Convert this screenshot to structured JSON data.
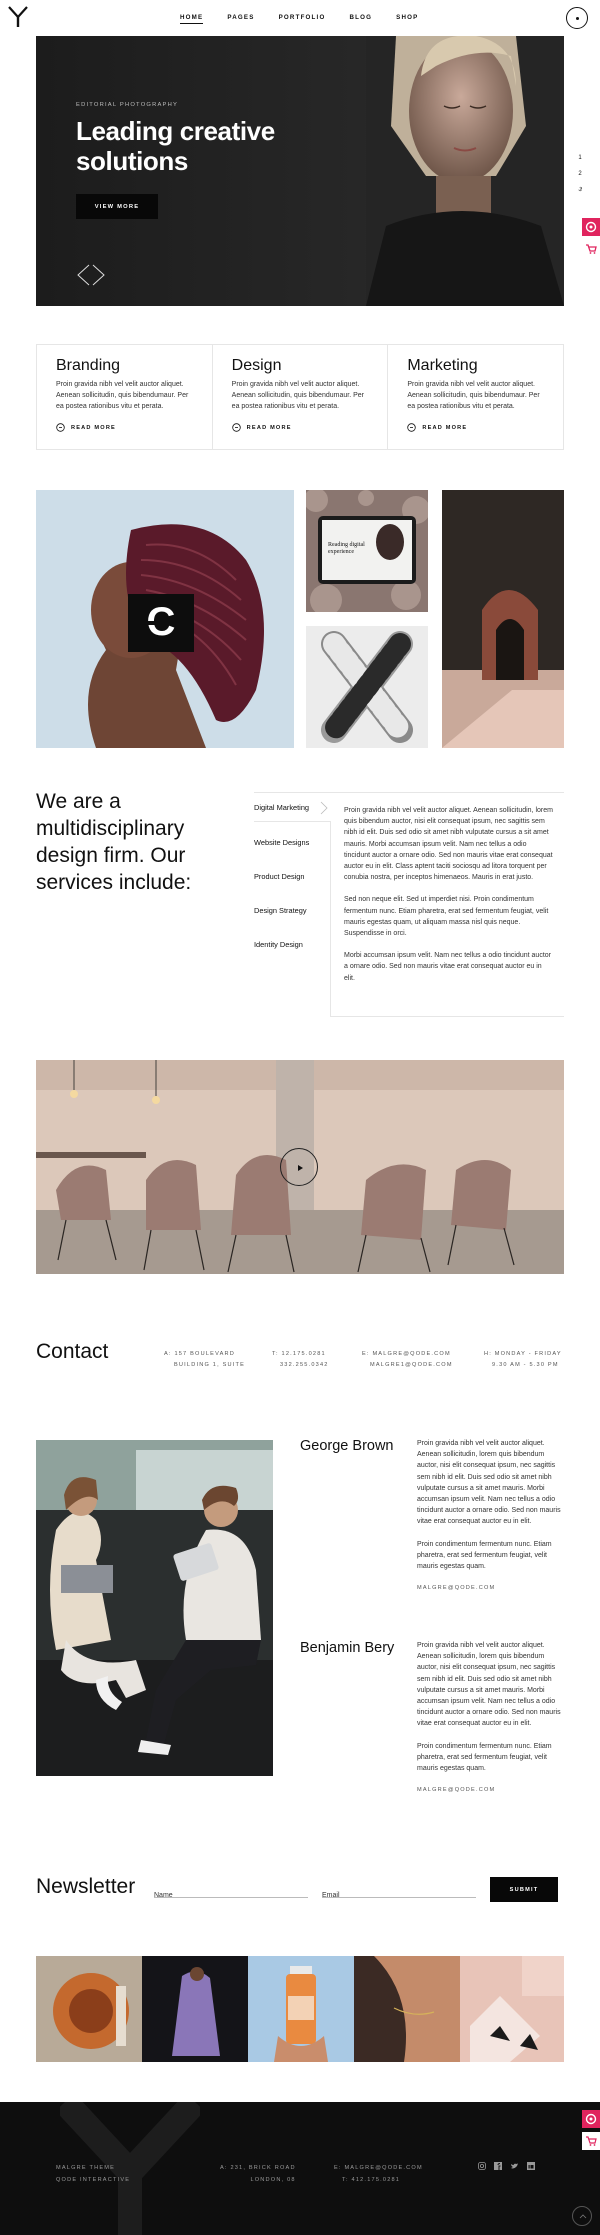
{
  "nav": {
    "items": [
      "HOME",
      "PAGES",
      "PORTFOLIO",
      "BLOG",
      "SHOP"
    ]
  },
  "hero": {
    "kicker": "EDITORIAL PHOTOGRAPHY",
    "title_line1": "Leading creative",
    "title_line2": "solutions",
    "button": "VIEW MORE"
  },
  "side": {
    "nums": [
      "1",
      "2",
      "3"
    ]
  },
  "services": [
    {
      "title": "Branding",
      "text": "Proin gravida nibh vel velit auctor aliquet. Aenean sollicitudin, quis bibendumaur. Per ea postea rationibus vitu et perata.",
      "link": "READ MORE"
    },
    {
      "title": "Design",
      "text": "Proin gravida nibh vel velit auctor aliquet. Aenean sollicitudin, quis bibendumaur. Per ea postea rationibus vitu et perata.",
      "link": "READ MORE"
    },
    {
      "title": "Marketing",
      "text": "Proin gravida nibh vel velit auctor aliquet. Aenean sollicitudin, quis bibendumaur. Per ea postea rationibus vitu et perata.",
      "link": "READ MORE"
    }
  ],
  "gallery": {
    "screen_title": "Reading digital experience"
  },
  "about": {
    "heading": "We are a multidisciplinary design firm. Our services include:",
    "tabs": [
      "Digital Marketing",
      "Website Designs",
      "Product Design",
      "Design Strategy",
      "Identity Design"
    ],
    "p1": "Proin gravida nibh vel velit auctor aliquet. Aenean sollicitudin, lorem quis bibendum auctor, nisi elit consequat ipsum, nec sagittis sem nibh id elit. Duis sed odio sit amet nibh vulputate cursus a sit amet mauris. Morbi accumsan ipsum velit. Nam nec tellus a odio tincidunt auctor a ornare odio. Sed non mauris vitae erat consequat auctor eu in elit. Class aptent taciti sociosqu ad litora torquent per conubia nostra, per inceptos himenaeos. Mauris in erat justo.",
    "p2": "Sed non neque elit. Sed ut imperdiet nisi. Proin condimentum fermentum nunc. Etiam pharetra, erat sed fermentum feugiat, velit mauris egestas quam, ut aliquam massa nisl quis neque. Suspendisse in orci.",
    "p3": "Morbi accumsan ipsum velit. Nam nec tellus a odio tincidunt auctor a ornare odio. Sed non mauris vitae erat consequat auctor eu in elit."
  },
  "contact": {
    "title": "Contact",
    "address": [
      "A: 157 BOULEVARD",
      "BUILDING 1, SUITE"
    ],
    "phone": [
      "T: 12.175.0281",
      "332.255.0342"
    ],
    "email": [
      "E: MALGRE@QODE.COM",
      "MALGRE1@QODE.COM"
    ],
    "hours": [
      "H: MONDAY - FRIDAY",
      "9.30 AM - 5.30 PM"
    ]
  },
  "team": [
    {
      "name": "George Brown",
      "p1": "Proin gravida nibh vel velit auctor aliquet. Aenean sollicitudin, lorem quis bibendum auctor, nisi elit consequat ipsum, nec sagittis sem nibh id elit. Duis sed odio sit amet nibh vulputate cursus a sit amet mauris. Morbi accumsan ipsum velit. Nam nec tellus a odio tincidunt auctor a ornare odio. Sed non mauris vitae erat consequat auctor eu in elit.",
      "p2": "Proin condimentum fermentum nunc. Etiam pharetra, erat sed fermentum feugiat, velit mauris egestas quam.",
      "email": "MALGRE@QODE.COM"
    },
    {
      "name": "Benjamin Bery",
      "p1": "Proin gravida nibh vel velit auctor aliquet. Aenean sollicitudin, lorem quis bibendum auctor, nisi elit consequat ipsum, nec sagittis sem nibh id elit. Duis sed odio sit amet nibh vulputate cursus a sit amet mauris. Morbi accumsan ipsum velit. Nam nec tellus a odio tincidunt auctor a ornare odio. Sed non mauris vitae erat consequat auctor eu in elit.",
      "p2": "Proin condimentum fermentum nunc. Etiam pharetra, erat sed fermentum feugiat, velit mauris egestas quam.",
      "email": "MALGRE@QODE.COM"
    }
  ],
  "newsletter": {
    "title": "Newsletter",
    "name_placeholder": "Name",
    "email_placeholder": "Email",
    "submit": "SUBMIT"
  },
  "footer": {
    "col1": [
      "MALGRE THEME",
      "QODE INTERACTIVE"
    ],
    "col2": [
      "A: 231, BRICK ROAD",
      "LONDON, 08"
    ],
    "col3": [
      "E: MALGRE@QODE.COM",
      "T: 412.175.0281"
    ]
  },
  "colors": {
    "accent": "#e0245e",
    "dark": "#0e0e0e"
  }
}
